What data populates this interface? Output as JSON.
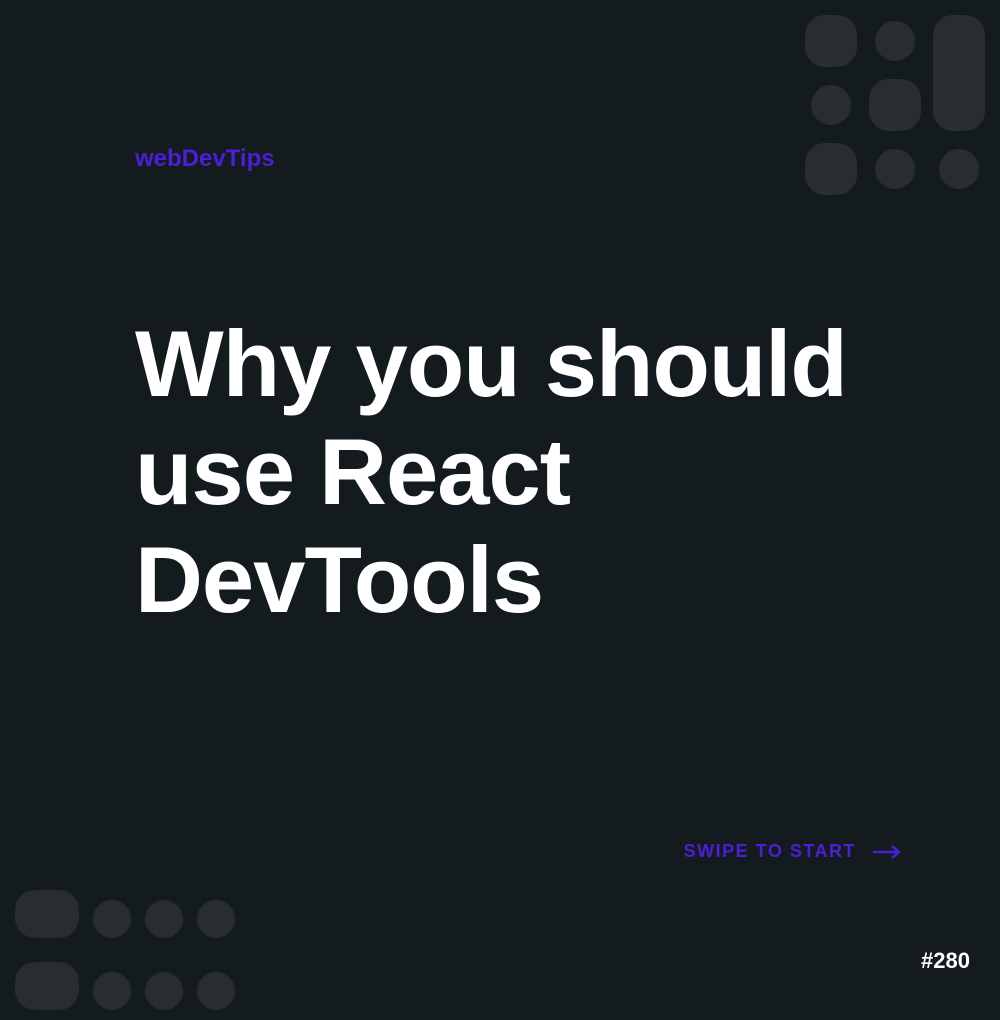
{
  "brand": "webDevTips",
  "title": "Why you should use React DevTools",
  "cta": "SWIPE TO START",
  "post_number": "#280",
  "colors": {
    "background": "#141b1f",
    "accent": "#4a1fd6",
    "text": "#ffffff"
  }
}
